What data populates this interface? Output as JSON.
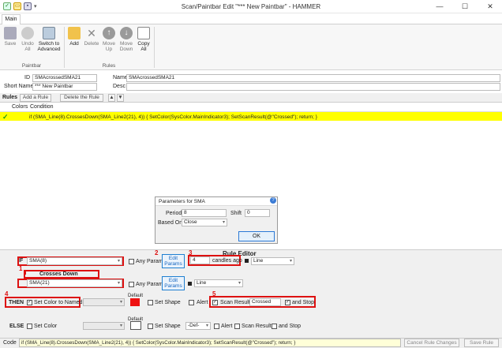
{
  "window": {
    "title": "Scan/Paintbar Edit \"*** New Paintbar\" - HAMMER",
    "qat_icons": [
      "check-icon",
      "open-icon",
      "save-icon",
      "dropdown-icon"
    ],
    "controls": [
      "—",
      "☐",
      "✕"
    ]
  },
  "tabs": [
    "Main"
  ],
  "ribbon": {
    "groups": [
      {
        "label": "Paintbar",
        "buttons": [
          {
            "label": "Save",
            "icon": "save-icon",
            "enabled": false
          },
          {
            "label": "Undo All",
            "icon": "undo-icon",
            "enabled": false
          },
          {
            "label": "Switch to Advanced",
            "icon": "switch-advanced-icon",
            "enabled": true
          }
        ]
      },
      {
        "label": "Rules",
        "buttons": [
          {
            "label": "Add",
            "icon": "add-folder-icon",
            "enabled": true
          },
          {
            "label": "Delete",
            "icon": "delete-icon",
            "enabled": false
          },
          {
            "label": "Move Up",
            "icon": "move-up-icon",
            "enabled": false
          },
          {
            "label": "Move Down",
            "icon": "move-down-icon",
            "enabled": false
          },
          {
            "label": "Copy All",
            "icon": "copy-icon",
            "enabled": true
          }
        ]
      }
    ]
  },
  "form": {
    "id_label": "ID",
    "id_value": "SMAcrossedSMA21",
    "name_label": "Name",
    "name_value": "SMAcrossedSMA21",
    "short_label": "Short Name",
    "short_value": "*** New Paintbar",
    "desc_label": "Desc",
    "desc_value": ""
  },
  "rules": {
    "header": "Rules",
    "add_btn": "Add a Rule",
    "delete_btn": "Delete the Rule",
    "col_colors": "Colors",
    "col_condition": "Condition",
    "row_condition": "if (SMA_Line(8).CrossesDown(SMA_Line2(21), 4)) {  SetColor(SysColor.MainIndicator3);  SetScanResult(@\"Crossed\");  return; }"
  },
  "dialog": {
    "title": "Parameters for SMA",
    "period_label": "Period",
    "period_value": "8",
    "shift_label": "Shift",
    "shift_value": "0",
    "based_label": "Based On",
    "based_value": "Close",
    "ok": "OK"
  },
  "editor": {
    "title": "Rule Editor",
    "if_label": "IF",
    "if_value": "SMA(8)",
    "any_params": "Any Params",
    "edit_params": "Edit Params",
    "candles_value": "4",
    "candles_label": "candles ago",
    "line_value": "Line",
    "crosses": "Crosses Down",
    "second_value": "SMA(21)",
    "then_label": "THEN",
    "set_color_named": "Set Color to Named",
    "default_label": "Default",
    "set_shape": "Set Shape",
    "alert": "Alert",
    "scan_result": "Scan Result",
    "scan_value": "Crossed",
    "and_stop": "and Stop",
    "else_label": "ELSE",
    "set_color": "Set Color",
    "def_value": "-Def-",
    "markers": [
      "1",
      "2",
      "3",
      "4",
      "5"
    ],
    "then_color": "#ee1111"
  },
  "codebar": {
    "label": "Code",
    "value": "if (SMA_Line(8).CrossesDown(SMA_Line2(21), 4)) {  SetColor(SysColor.MainIndicator3);  SetScanResult(@\"Crossed\");  return; }",
    "cancel": "Cancel Rule Changes",
    "save": "Save Rule"
  }
}
